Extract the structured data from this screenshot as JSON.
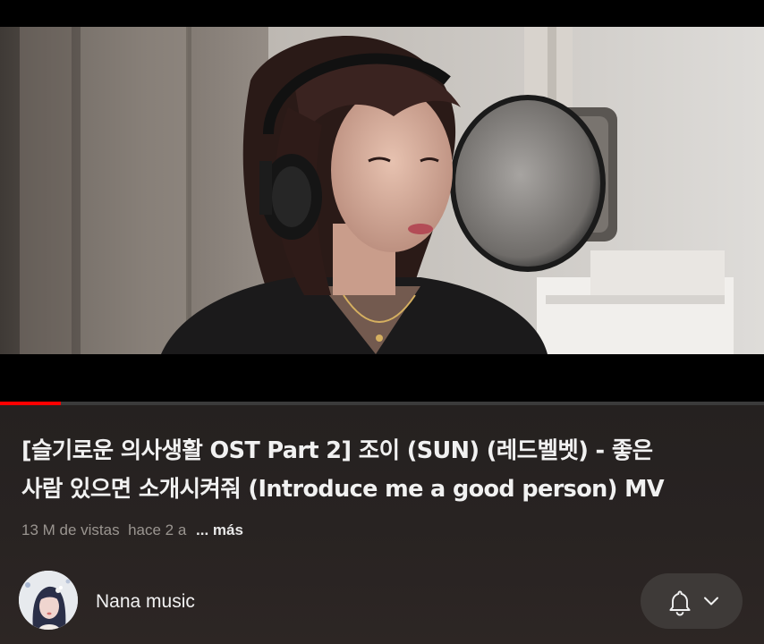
{
  "video": {
    "progress_fraction": 0.08,
    "progress_color": "#ff0000"
  },
  "video_info": {
    "title_line1": "[슬기로운 의사생활 OST Part 2] 조이 (SUN) (레드벨벳) - 좋은",
    "title_line2": "사람 있으면 소개시켜줘 (Introduce me a good person) MV",
    "views": "13 M de vistas",
    "age": "hace 2 a",
    "more_label": "... más"
  },
  "channel": {
    "name": "Nana music",
    "avatar_icon": "channel-avatar",
    "subscribe_icons": [
      "bell-icon",
      "chevron-down-icon"
    ]
  },
  "colors": {
    "background": "#0f0f0f",
    "title_text": "#f1f1f1",
    "meta_text": "#9a9590",
    "button_bg": "#3e3a38"
  }
}
